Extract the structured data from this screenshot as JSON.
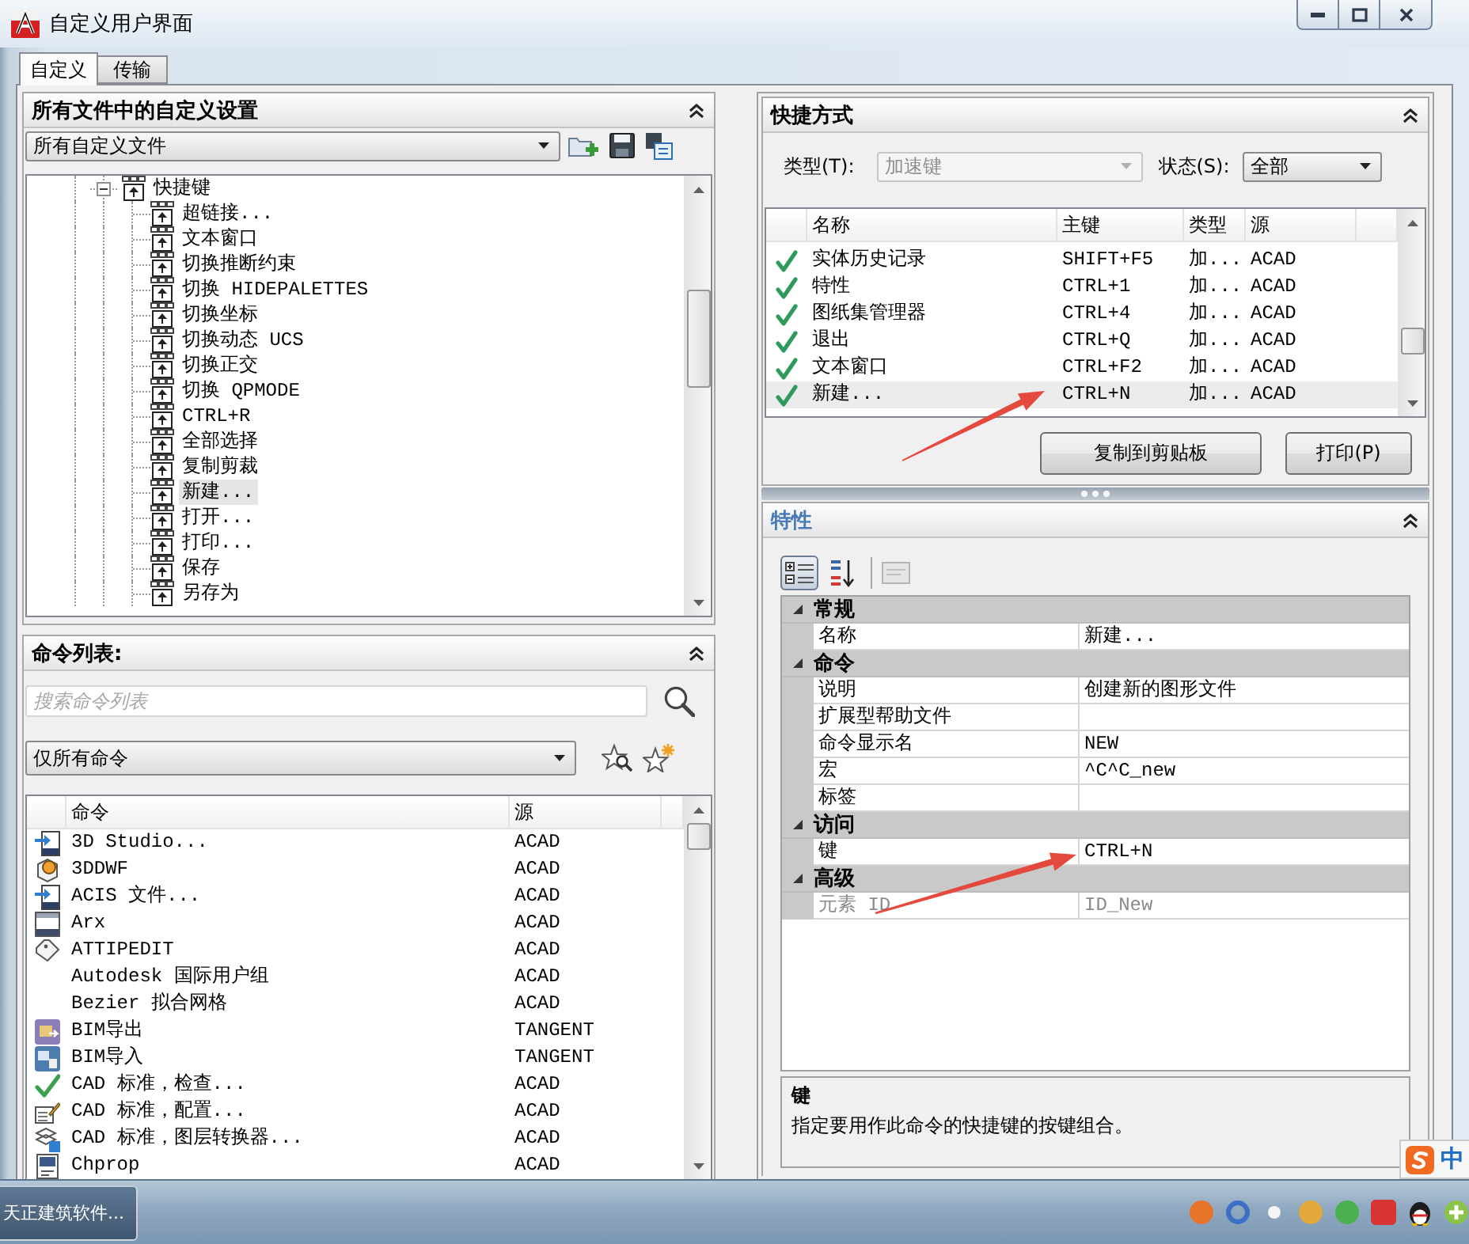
{
  "window": {
    "title": "自定义用户界面"
  },
  "tabs": [
    {
      "label": "自定义",
      "selected": true
    },
    {
      "label": "传输",
      "selected": false
    }
  ],
  "customizations": {
    "title": "所有文件中的自定义设置",
    "file_dropdown": {
      "value": "所有自定义文件"
    },
    "tree": [
      {
        "label": "快捷键",
        "expanded": true,
        "selected": false,
        "children": [
          {
            "label": "超链接...",
            "selected": false
          },
          {
            "label": "文本窗口",
            "selected": false
          },
          {
            "label": "切换推断约束",
            "selected": false
          },
          {
            "label": "切换 HIDEPALETTES",
            "selected": false
          },
          {
            "label": "切换坐标",
            "selected": false
          },
          {
            "label": "切换动态 UCS",
            "selected": false
          },
          {
            "label": "切换正交",
            "selected": false
          },
          {
            "label": "切换 QPMODE",
            "selected": false
          },
          {
            "label": "CTRL+R",
            "selected": false
          },
          {
            "label": "全部选择",
            "selected": false
          },
          {
            "label": "复制剪裁",
            "selected": false
          },
          {
            "label": "新建...",
            "selected": true
          },
          {
            "label": "打开...",
            "selected": false
          },
          {
            "label": "打印...",
            "selected": false
          },
          {
            "label": "保存",
            "selected": false
          },
          {
            "label": "另存为",
            "selected": false
          }
        ]
      }
    ]
  },
  "command_list": {
    "title": "命令列表:",
    "search": {
      "placeholder": "搜索命令列表"
    },
    "filter_dropdown": {
      "value": "仅所有命令"
    },
    "columns": [
      "命令",
      "源"
    ],
    "rows": [
      {
        "kind": "import",
        "command": "3D Studio...",
        "source": "ACAD"
      },
      {
        "kind": "globe",
        "command": "3DDWF",
        "source": "ACAD"
      },
      {
        "kind": "import",
        "command": "ACIS 文件...",
        "source": "ACAD"
      },
      {
        "kind": "window",
        "command": "Arx",
        "source": "ACAD"
      },
      {
        "kind": "tag",
        "command": "ATTIPEDIT",
        "source": "ACAD"
      },
      {
        "kind": "plain",
        "command": "Autodesk 国际用户组",
        "source": "ACAD"
      },
      {
        "kind": "plain",
        "command": "Bezier 拟合网格",
        "source": "ACAD"
      },
      {
        "kind": "export-tile",
        "command": "BIM导出",
        "source": "TANGENT"
      },
      {
        "kind": "import-tile",
        "command": "BIM导入",
        "source": "TANGENT"
      },
      {
        "kind": "check",
        "command": "CAD 标准，检查...",
        "source": "ACAD"
      },
      {
        "kind": "document-pen",
        "command": "CAD 标准，配置...",
        "source": "ACAD"
      },
      {
        "kind": "layers",
        "command": "CAD 标准，图层转换器...",
        "source": "ACAD"
      },
      {
        "kind": "list-window",
        "command": "Chprop",
        "source": "ACAD"
      }
    ]
  },
  "shortcuts": {
    "title": "快捷方式",
    "type_filter": {
      "label": "类型(T):",
      "value": "加速键",
      "disabled": true
    },
    "status_filter": {
      "label": "状态(S):",
      "value": "全部",
      "disabled": false
    },
    "columns": [
      "名称",
      "主键",
      "类型",
      "源"
    ],
    "rows": [
      {
        "name": "实体历史记录",
        "key": "SHIFT+F5",
        "type": "加...",
        "source": "ACAD",
        "selected": false
      },
      {
        "name": "特性",
        "key": "CTRL+1",
        "type": "加...",
        "source": "ACAD",
        "selected": false
      },
      {
        "name": "图纸集管理器",
        "key": "CTRL+4",
        "type": "加...",
        "source": "ACAD",
        "selected": false
      },
      {
        "name": "退出",
        "key": "CTRL+Q",
        "type": "加...",
        "source": "ACAD",
        "selected": false
      },
      {
        "name": "文本窗口",
        "key": "CTRL+F2",
        "type": "加...",
        "source": "ACAD",
        "selected": false
      },
      {
        "name": "新建...",
        "key": "CTRL+N",
        "type": "加...",
        "source": "ACAD",
        "selected": true
      }
    ],
    "buttons": [
      {
        "label": "复制到剪贴板"
      },
      {
        "label": "打印(P)"
      }
    ]
  },
  "properties": {
    "title": "特性",
    "view_buttons": [
      {
        "kind": "categorized",
        "selected": true
      },
      {
        "kind": "alphabetical",
        "selected": false
      }
    ],
    "pages_button": {
      "disabled": true
    },
    "categories": [
      {
        "label": "常规",
        "expanded": true,
        "properties": [
          {
            "name": "名称",
            "value": "新建...",
            "disabled": false
          }
        ]
      },
      {
        "label": "命令",
        "expanded": true,
        "properties": [
          {
            "name": "说明",
            "value": "创建新的图形文件",
            "disabled": false
          },
          {
            "name": "扩展型帮助文件",
            "disabled": false
          },
          {
            "name": "命令显示名",
            "value": "NEW",
            "disabled": false
          },
          {
            "name": "宏",
            "value": "^C^C_new",
            "disabled": false
          },
          {
            "name": "标签",
            "disabled": false
          }
        ]
      },
      {
        "label": "访问",
        "expanded": true,
        "properties": [
          {
            "name": "键",
            "value": "CTRL+N",
            "disabled": false
          }
        ]
      },
      {
        "label": "高级",
        "expanded": true,
        "properties": [
          {
            "name": "元素 ID",
            "value": "ID_New",
            "disabled": true
          }
        ]
      }
    ],
    "description": {
      "title": "键",
      "text": "指定要用作此命令的快捷键的按键组合。"
    }
  },
  "taskbar": {
    "buttons": [
      {
        "label": "天正建筑软件..."
      }
    ],
    "ime": {
      "label": "中"
    }
  }
}
